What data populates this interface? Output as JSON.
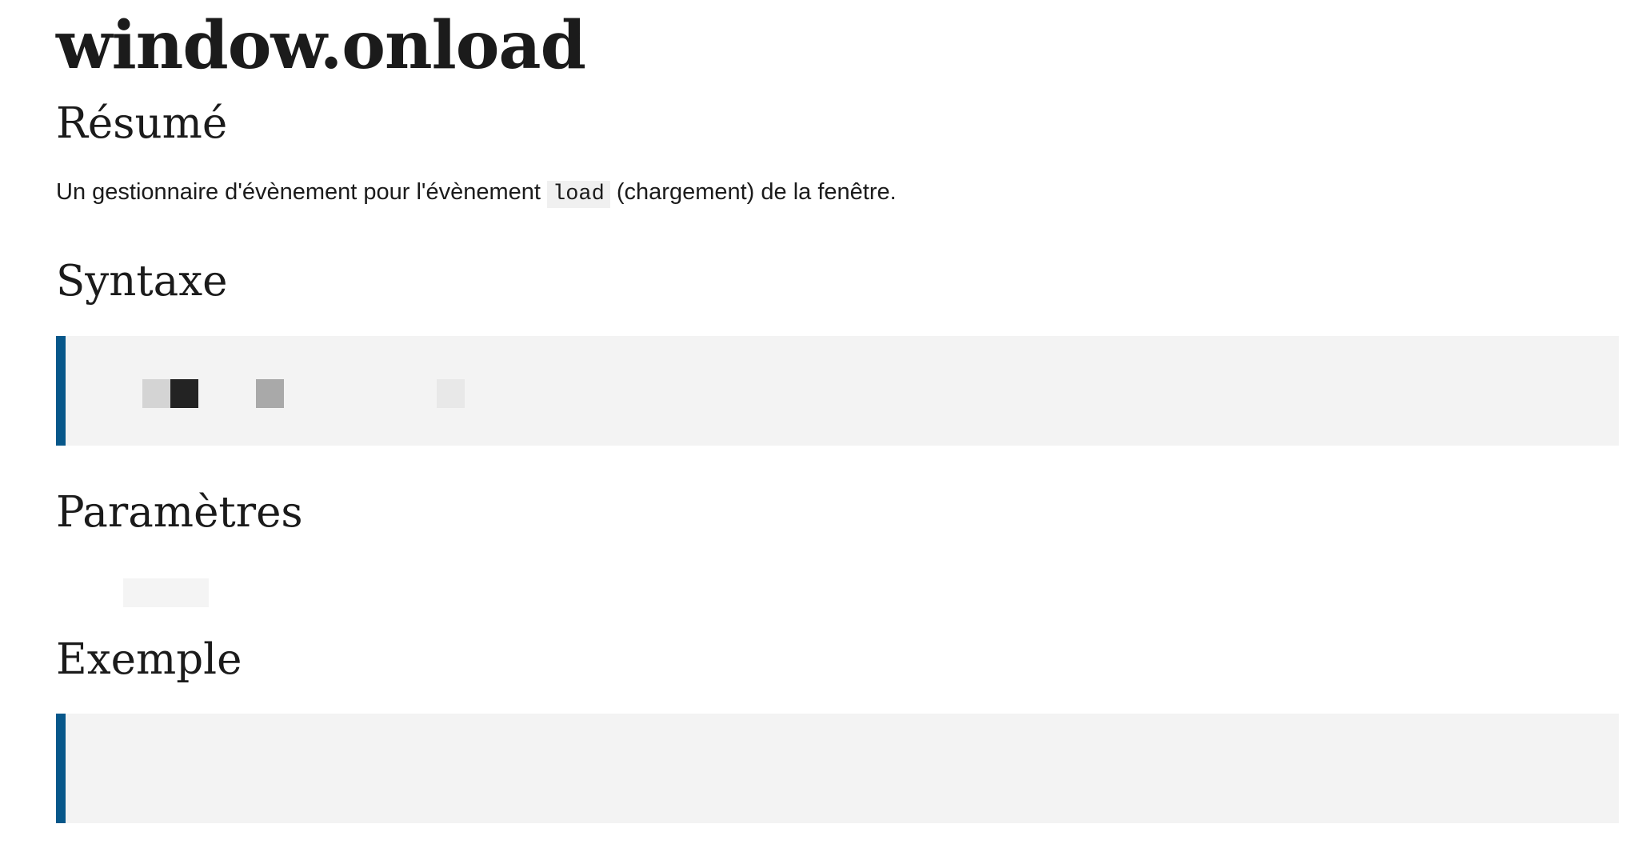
{
  "page": {
    "title": "window.onload"
  },
  "sections": {
    "summary": {
      "heading": "Résumé",
      "text_before": "Un gestionnaire d'évènement pour l'évènement ",
      "code": "load",
      "text_after": " (chargement) de la fenêtre."
    },
    "syntax": {
      "heading": "Syntaxe"
    },
    "parameters": {
      "heading": "Paramètres"
    },
    "example": {
      "heading": "Exemple"
    }
  },
  "colors": {
    "accent_border": "#07578a",
    "code_background": "#f3f3f3",
    "text": "#1b1b1b"
  }
}
